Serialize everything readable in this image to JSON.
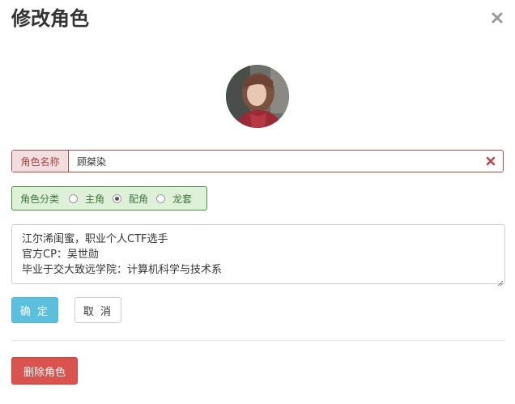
{
  "dialog": {
    "title": "修改角色"
  },
  "name_field": {
    "label": "角色名称",
    "value": "顾桀染"
  },
  "category": {
    "label": "角色分类",
    "options": [
      "主角",
      "配角",
      "龙套"
    ],
    "selected": "配角"
  },
  "description": {
    "lines": [
      "江尔浠闺蜜，职业个人CTF选手",
      "官方CP：吴世勋",
      "毕业于交大致远学院：计算机科学与技术系"
    ]
  },
  "buttons": {
    "confirm": "确 定",
    "cancel": "取 消",
    "delete": "删除角色"
  },
  "colors": {
    "danger": "#d9534f",
    "info": "#5bc0de",
    "success_bg": "#dff0d8",
    "error_bg": "#f2dede"
  }
}
